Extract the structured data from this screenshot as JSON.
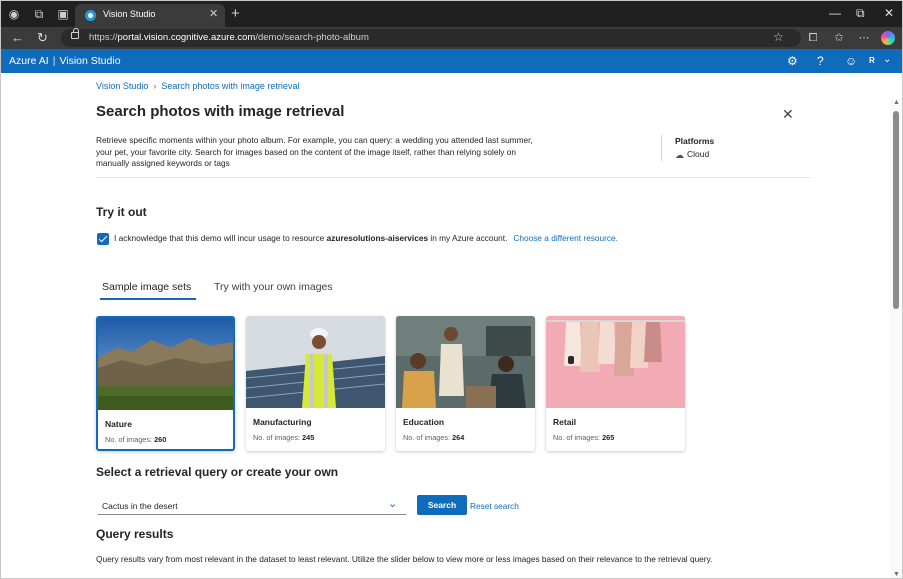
{
  "browser": {
    "tab_title": "Vision Studio",
    "url_domain": "portal.vision.cognitive.azure.com",
    "url_path": "/demo/search-photo-album",
    "url_scheme": "https://"
  },
  "app": {
    "brand": "Azure AI",
    "product": "Vision Studio",
    "avatar_initial": "R",
    "accent_color": "#0f6cbd"
  },
  "breadcrumb": {
    "root": "Vision Studio",
    "current": "Search photos with image retrieval"
  },
  "page": {
    "title": "Search photos with image retrieval",
    "description": "Retrieve specific moments within your photo album. For example, you can query: a wedding you attended last summer, your pet, your favorite city. Search for images based on the content of the image itself, rather than relying solely on manually assigned keywords or tags",
    "platforms_label": "Platforms",
    "platforms_value": "Cloud"
  },
  "try_it_out": {
    "title": "Try it out",
    "ack_prefix": "I acknowledge that this demo will incur usage to resource ",
    "ack_resource": "azuresolutions-aiservices",
    "ack_suffix": " in my Azure account.",
    "ack_link": "Choose a different resource.",
    "checked": true
  },
  "tabs": [
    {
      "label": "Sample image sets",
      "active": true
    },
    {
      "label": "Try with your own images",
      "active": false
    }
  ],
  "image_sets": [
    {
      "name": "Nature",
      "count_label": "No. of images:",
      "count": "260",
      "selected": true
    },
    {
      "name": "Manufacturing",
      "count_label": "No. of images:",
      "count": "245",
      "selected": false
    },
    {
      "name": "Education",
      "count_label": "No. of images:",
      "count": "264",
      "selected": false
    },
    {
      "name": "Retail",
      "count_label": "No. of images:",
      "count": "265",
      "selected": false
    }
  ],
  "query": {
    "title": "Select a retrieval query or create your own",
    "selected": "Cactus in the desert",
    "search_label": "Search",
    "reset_label": "Reset search"
  },
  "results": {
    "title": "Query results",
    "description": "Query results vary from most relevant in the dataset to least relevant. Utilize the slider below to view more or less images based on their relevance to the retrieval query."
  }
}
